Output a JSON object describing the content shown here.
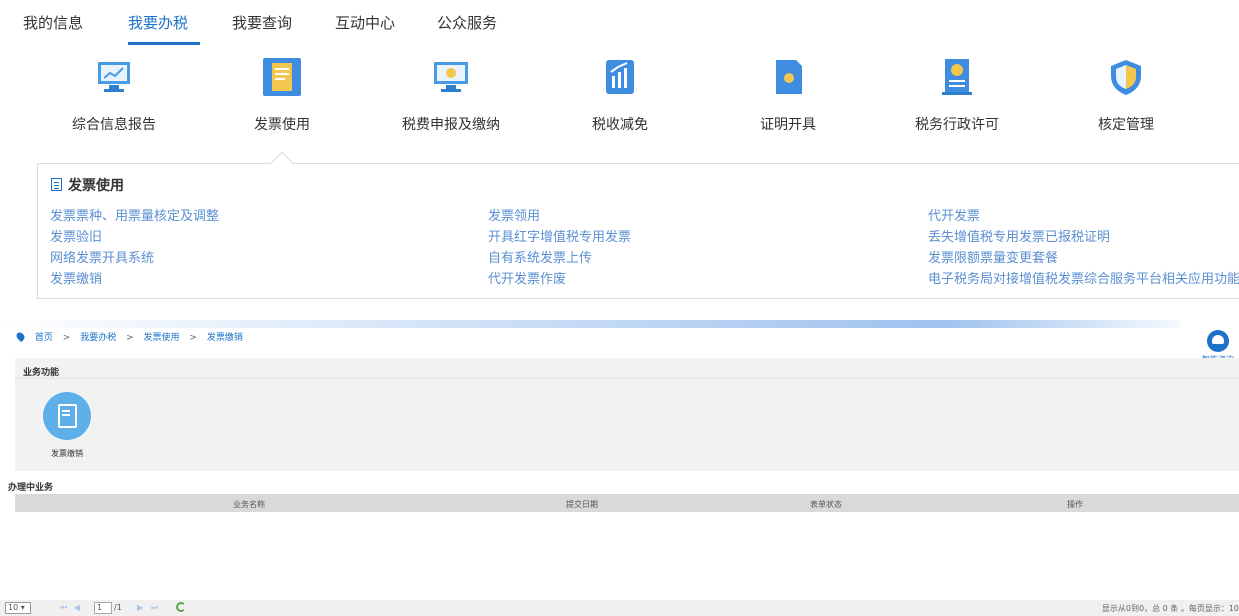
{
  "topnav": {
    "tabs": [
      "我的信息",
      "我要办税",
      "我要查询",
      "互动中心",
      "公众服务"
    ],
    "active": "我要办税"
  },
  "categories": [
    {
      "label": "综合信息报告",
      "icon": "monitor-chart-icon"
    },
    {
      "label": "发票使用",
      "icon": "invoice-document-icon"
    },
    {
      "label": "税费申报及缴纳",
      "icon": "monitor-coin-icon"
    },
    {
      "label": "税收减免",
      "icon": "chart-reduction-icon"
    },
    {
      "label": "证明开具",
      "icon": "certificate-icon"
    },
    {
      "label": "税务行政许可",
      "icon": "license-badge-icon"
    },
    {
      "label": "核定管理",
      "icon": "shield-icon"
    }
  ],
  "panel": {
    "title": "发票使用",
    "col1": [
      "发票票种、用票量核定及调整",
      "发票验旧",
      "网络发票开具系统",
      "发票缴销"
    ],
    "col2": [
      "发票领用",
      "开具红字增值税专用发票",
      "自有系统发票上传",
      "代开发票作废"
    ],
    "col3": [
      "代开发票",
      "丢失增值税专用发票已报税证明",
      "发票限额票量变更套餐",
      "电子税务局对接增值税发票综合服务平台相关应用功能"
    ]
  },
  "breadcrumb": {
    "home": "首页",
    "sep": ">",
    "level1": "我要办税",
    "level2": "发票使用",
    "level3": "发票缴销"
  },
  "help": {
    "label": "智能咨询"
  },
  "functions": {
    "heading": "业务功能",
    "items": [
      {
        "label": "发票缴销",
        "icon": "invoice-edit-icon"
      }
    ]
  },
  "pending": {
    "heading": "办理中业务",
    "columns": [
      "业务名称",
      "提交日期",
      "表单状态",
      "操作"
    ]
  },
  "pager": {
    "page_size": "10",
    "current_page": "1",
    "total_pages": "/1",
    "info": "显示从0到0，总 0 条 。每页显示：10"
  },
  "colors": {
    "accent": "#1d71c9",
    "link": "#5b8fd2"
  }
}
